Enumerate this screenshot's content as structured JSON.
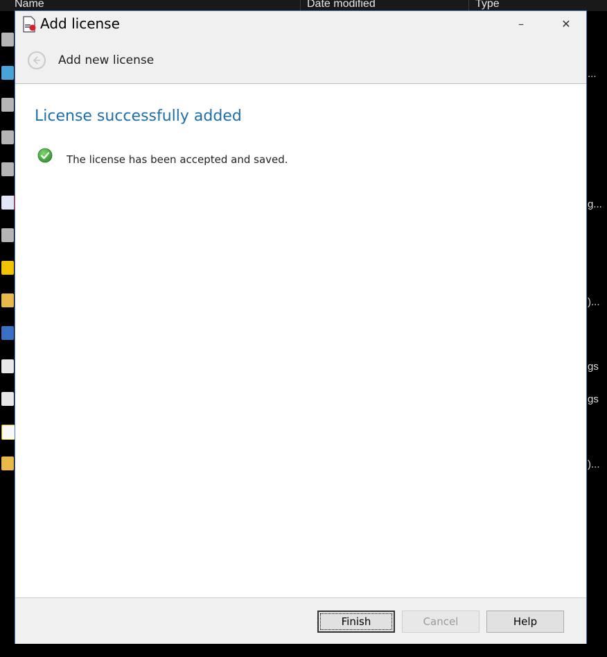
{
  "background": {
    "columns": [
      "Name",
      "Date modified",
      "Type"
    ],
    "row_tails": [
      "...",
      "g...",
      ")...",
      "gs",
      "gs",
      ")..."
    ]
  },
  "dialog": {
    "title": "Add license",
    "minimize_glyph": "–",
    "close_glyph": "✕",
    "nav_title": "Add new license",
    "heading": "License successfully added",
    "message": "The license has been accepted and saved.",
    "buttons": {
      "finish": "Finish",
      "cancel": "Cancel",
      "help": "Help"
    }
  },
  "colors": {
    "accent": "#1e6fa8",
    "success": "#3aa63a",
    "window_border": "#4a7fc1"
  }
}
